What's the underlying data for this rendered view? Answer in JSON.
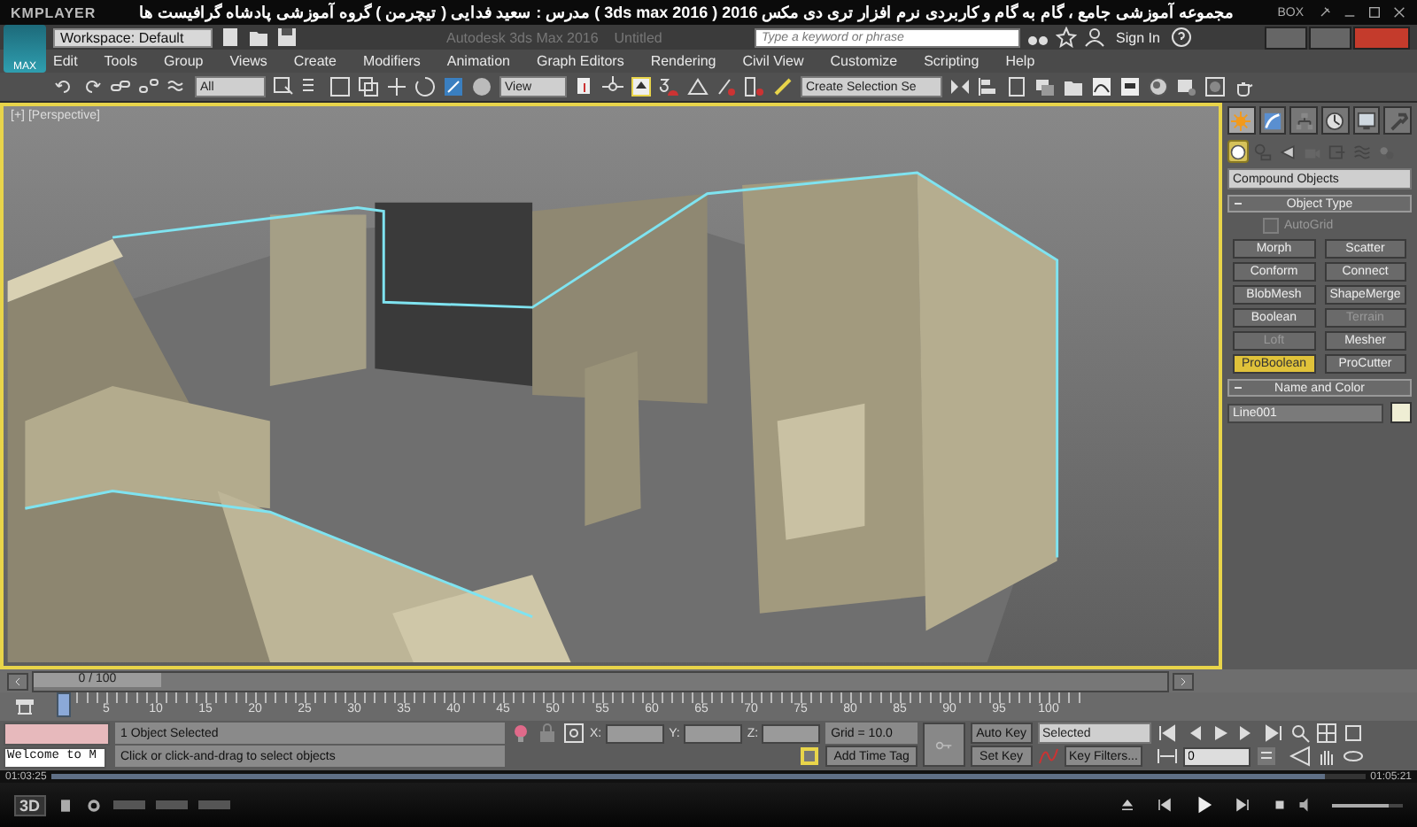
{
  "player": {
    "logo": "KMPLAYER",
    "title": "مجموعه آموزشی جامع ، گام به گام و کاربردی نرم افزار تری دی مکس 2016 ( 3ds max 2016 ) مدرس : سعید فدایی ( تیچرمن ) گروه آموزشی پادشاه گرافیست ها",
    "box_label": "BOX",
    "mode_label": "3D",
    "elapsed": "01:03:25",
    "duration": "01:05:21",
    "seek": {
      "level": 0.97
    },
    "volume": {
      "level": 0.8
    }
  },
  "app": {
    "logo": "MAX",
    "workspace": "Workspace: Default",
    "title": "Autodesk 3ds Max 2016    Untitled",
    "search": {
      "placeholder": "Type a keyword or phrase"
    },
    "sign_in": "Sign In"
  },
  "menu": [
    "Edit",
    "Tools",
    "Group",
    "Views",
    "Create",
    "Modifiers",
    "Animation",
    "Graph Editors",
    "Rendering",
    "Civil View",
    "Customize",
    "Scripting",
    "Help"
  ],
  "toolbar": {
    "selection_filter": "All",
    "reference_coord": "View",
    "selection_set": "Create Selection Se"
  },
  "viewport": {
    "labels": [
      "[+]",
      "[Perspective]"
    ]
  },
  "command_panel": {
    "tabs": [
      {
        "kind": "create",
        "selected": true
      },
      {
        "kind": "modify",
        "selected": false
      },
      {
        "kind": "hierarchy",
        "selected": false
      },
      {
        "kind": "motion",
        "selected": false
      },
      {
        "kind": "display",
        "selected": false
      },
      {
        "kind": "utilities",
        "selected": false
      }
    ],
    "categories": [
      {
        "kind": "geometry",
        "selected": true
      },
      {
        "kind": "shapes",
        "selected": false
      },
      {
        "kind": "lights",
        "selected": false
      },
      {
        "kind": "cameras",
        "selected": false
      },
      {
        "kind": "helpers",
        "selected": false
      },
      {
        "kind": "spacewarps",
        "selected": false
      },
      {
        "kind": "systems",
        "selected": false
      }
    ],
    "category_dropdown": "Compound Objects",
    "object_type": {
      "title": "Object Type",
      "autogrid": {
        "label": "AutoGrid",
        "checked": false,
        "disabled": true
      },
      "buttons": [
        {
          "label": "Morph",
          "disabled": false,
          "selected": false
        },
        {
          "label": "Scatter",
          "disabled": false,
          "selected": false
        },
        {
          "label": "Conform",
          "disabled": false,
          "selected": false
        },
        {
          "label": "Connect",
          "disabled": false,
          "selected": false
        },
        {
          "label": "BlobMesh",
          "disabled": false,
          "selected": false
        },
        {
          "label": "ShapeMerge",
          "disabled": false,
          "selected": false
        },
        {
          "label": "Boolean",
          "disabled": false,
          "selected": false
        },
        {
          "label": "Terrain",
          "disabled": true,
          "selected": false
        },
        {
          "label": "Loft",
          "disabled": true,
          "selected": false
        },
        {
          "label": "Mesher",
          "disabled": false,
          "selected": false
        },
        {
          "label": "ProBoolean",
          "disabled": false,
          "selected": true
        },
        {
          "label": "ProCutter",
          "disabled": false,
          "selected": false
        }
      ]
    },
    "name_and_color": {
      "title": "Name and Color",
      "name": "Line001",
      "color": "#efeed4"
    }
  },
  "time_slider": {
    "label": "0 / 100",
    "level": 0
  },
  "ruler": {
    "labels": [
      "5",
      "10",
      "15",
      "20",
      "25",
      "30",
      "35",
      "40",
      "45",
      "50",
      "55",
      "60",
      "65",
      "70",
      "75",
      "80",
      "85",
      "90",
      "95",
      "100"
    ]
  },
  "status": {
    "listener": "Welcome to M",
    "selection": "1 Object Selected",
    "prompt": "Click or click-and-drag to select objects",
    "coords": [
      "X:",
      "Y:",
      "Z:"
    ],
    "grid": "Grid = 10.0",
    "time_tag": "Add Time Tag"
  },
  "animation": {
    "auto_key": {
      "label": "Auto Key",
      "on": false
    },
    "key_mode": "Selected",
    "set_key": "Set Key",
    "key_filters": "Key Filters...",
    "frame": "0"
  }
}
